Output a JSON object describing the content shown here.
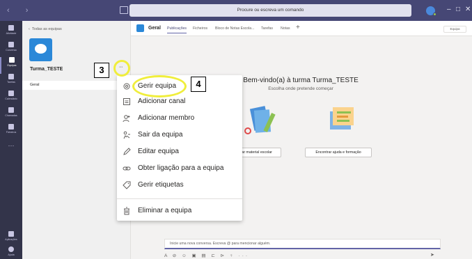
{
  "titlebar": {
    "nav_arrows": "‹ ›",
    "search_placeholder": "Procure ou escreva um comando",
    "win_minimize": "–",
    "win_maximize": "□",
    "win_close": "✕"
  },
  "appbar": {
    "items": [
      {
        "label": "Atividade",
        "icon": "bell-icon"
      },
      {
        "label": "Conversa",
        "icon": "chat-icon"
      },
      {
        "label": "Equipas",
        "icon": "teams-icon"
      },
      {
        "label": "Tarefas",
        "icon": "assignments-icon"
      },
      {
        "label": "Calendário",
        "icon": "calendar-icon"
      },
      {
        "label": "Chamadas",
        "icon": "phone-icon"
      },
      {
        "label": "Ficheiros",
        "icon": "file-icon"
      }
    ],
    "more": "···",
    "bottom": [
      {
        "label": "Aplicações",
        "icon": "apps-icon"
      },
      {
        "label": "Ajuda",
        "icon": "help-icon"
      }
    ]
  },
  "teams_panel": {
    "back_label": "Todas as equipas",
    "team_name": "Turma_TESTE",
    "more_label": "···",
    "channel": "Geral"
  },
  "channel_header": {
    "title": "Geral",
    "tabs": [
      "Publicações",
      "Ficheiros",
      "Bloco de Notas Escola...",
      "Tarefas",
      "Notas"
    ],
    "add_tab": "+",
    "team_chip": "Equipa"
  },
  "welcome": {
    "title": "Bem-vindo(a) à turma Turma_TESTE",
    "subtitle": "Escolha onde pretende começar",
    "button_left": "...egar material escolar",
    "button_right": "Encontrar ajuda e formação"
  },
  "compose": {
    "placeholder": "Inicie uma nova conversa. Escreva @ para mencionar alguém.",
    "tools": "A ⊘ ☺ ▣ ▤ ⊏ ⊳ ♀ ···",
    "send": "➤"
  },
  "menu": {
    "items": [
      {
        "label": "Gerir equipa",
        "icon": "gear-icon"
      },
      {
        "label": "Adicionar canal",
        "icon": "add-channel-icon"
      },
      {
        "label": "Adicionar membro",
        "icon": "add-person-icon"
      },
      {
        "label": "Sair da equipa",
        "icon": "leave-icon"
      },
      {
        "label": "Editar equipa",
        "icon": "pencil-icon"
      },
      {
        "label": "Obter ligação para a equipa",
        "icon": "link-icon"
      },
      {
        "label": "Gerir etiquetas",
        "icon": "tag-icon"
      },
      {
        "label": "Eliminar a equipa",
        "icon": "trash-icon"
      }
    ]
  },
  "callouts": {
    "step3": "3",
    "step4": "4"
  },
  "colors": {
    "titlebar": "#464775",
    "appbar": "#33344a",
    "accent": "#6264a7",
    "highlight": "#f0ee3c"
  }
}
